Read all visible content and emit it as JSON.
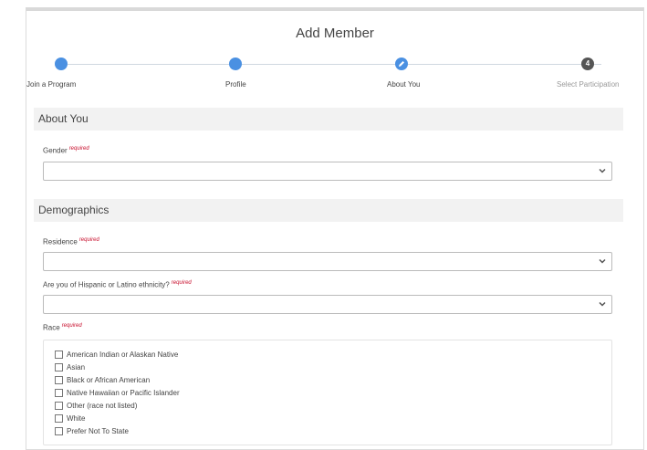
{
  "title": "Add Member",
  "steps": [
    {
      "label": "Join a Program",
      "state": "complete"
    },
    {
      "label": "Profile",
      "state": "complete"
    },
    {
      "label": "About You",
      "state": "current"
    },
    {
      "label": "Select Participation",
      "state": "upcoming",
      "number": "4"
    }
  ],
  "sections": {
    "about_you": "About You",
    "demographics": "Demographics"
  },
  "required_text": "required",
  "fields": {
    "gender": {
      "label": "Gender",
      "value": ""
    },
    "residence": {
      "label": "Residence",
      "value": ""
    },
    "hispanic": {
      "label": "Are you of Hispanic or Latino ethnicity?",
      "value": ""
    },
    "race": {
      "label": "Race"
    }
  },
  "race_options": [
    "American Indian or Alaskan Native",
    "Asian",
    "Black or African American",
    "Native Hawaiian or Pacific Islander",
    "Other (race not listed)",
    "White",
    "Prefer Not To State"
  ],
  "colors": {
    "accent": "#4a90e2",
    "required": "#c8102e",
    "section_bg": "#f2f2f2"
  },
  "icons": {
    "dropdown": "chevron-down-icon",
    "current_step": "pencil-icon"
  }
}
